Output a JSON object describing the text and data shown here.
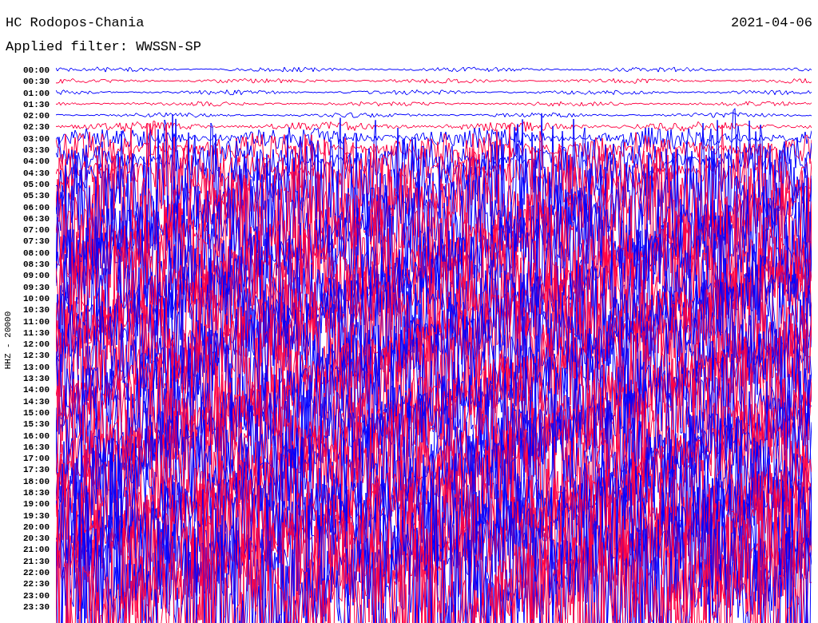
{
  "header": {
    "station": "HC Rodopos-Chania",
    "date": "2021-04-06",
    "filter": "Applied filter: WWSSN-SP"
  },
  "axis_label": "HHZ - 20000",
  "time_labels": [
    "00:00",
    "00:30",
    "01:00",
    "01:30",
    "02:00",
    "02:30",
    "03:00",
    "03:30",
    "04:00",
    "04:30",
    "05:00",
    "05:30",
    "06:00",
    "06:30",
    "07:00",
    "07:30",
    "08:00",
    "08:30",
    "09:00",
    "09:30",
    "10:00",
    "10:30",
    "11:00",
    "11:30",
    "12:00",
    "12:30",
    "13:00",
    "13:30",
    "14:00",
    "14:30",
    "15:00",
    "15:30",
    "16:00",
    "16:30",
    "17:00",
    "17:30",
    "18:00",
    "18:30",
    "19:00",
    "19:30",
    "20:00",
    "20:30",
    "21:00",
    "21:30",
    "22:00",
    "22:30",
    "23:00",
    "23:30"
  ]
}
